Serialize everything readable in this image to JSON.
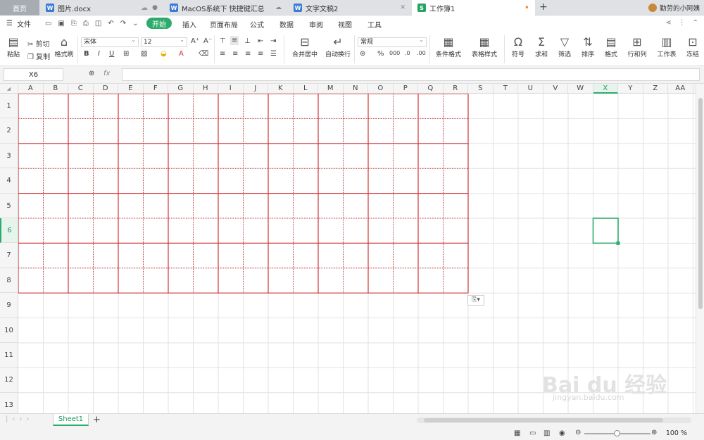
{
  "tabs": {
    "home": "首页",
    "t1": "图片.docx",
    "t2": "MacOS系统下 快捷键汇总",
    "t3": "文字文稿2",
    "t4": "工作簿1",
    "user": "勤劳的小阿姨"
  },
  "menu": {
    "file": "文件",
    "start": "开始",
    "items": [
      "插入",
      "页面布局",
      "公式",
      "数据",
      "审阅",
      "视图",
      "工具"
    ]
  },
  "ribbon": {
    "paste": "粘贴",
    "cut": "剪切",
    "copy": "复制",
    "format_painter": "格式刷",
    "font": "宋体",
    "size": "12",
    "number_format": "常规",
    "merge": "合并居中",
    "wrap": "自动换行",
    "cond": "条件格式",
    "table_style": "表格样式",
    "symbol": "符号",
    "sum": "求和",
    "filter": "筛选",
    "sort": "排序",
    "format": "格式",
    "rowcol": "行和列",
    "sheet": "工作表",
    "freeze": "冻结"
  },
  "formula": {
    "cell": "X6",
    "fx": "fx"
  },
  "columns": [
    "A",
    "B",
    "C",
    "D",
    "E",
    "F",
    "G",
    "H",
    "I",
    "J",
    "K",
    "L",
    "M",
    "N",
    "O",
    "P",
    "Q",
    "R",
    "S",
    "T",
    "U",
    "V",
    "W",
    "X",
    "Y",
    "Z",
    "AA"
  ],
  "rows": [
    "1",
    "2",
    "3",
    "4",
    "5",
    "6",
    "7",
    "8",
    "9",
    "10",
    "11",
    "12",
    "13"
  ],
  "sheet": {
    "name": "Sheet1"
  },
  "zoom": "100 %",
  "watermark": {
    "main": "Bai du 经验",
    "sub": "jingyan.baidu.com"
  },
  "colors": {
    "accent": "#2dab6a",
    "border_red": "#d0353a"
  }
}
